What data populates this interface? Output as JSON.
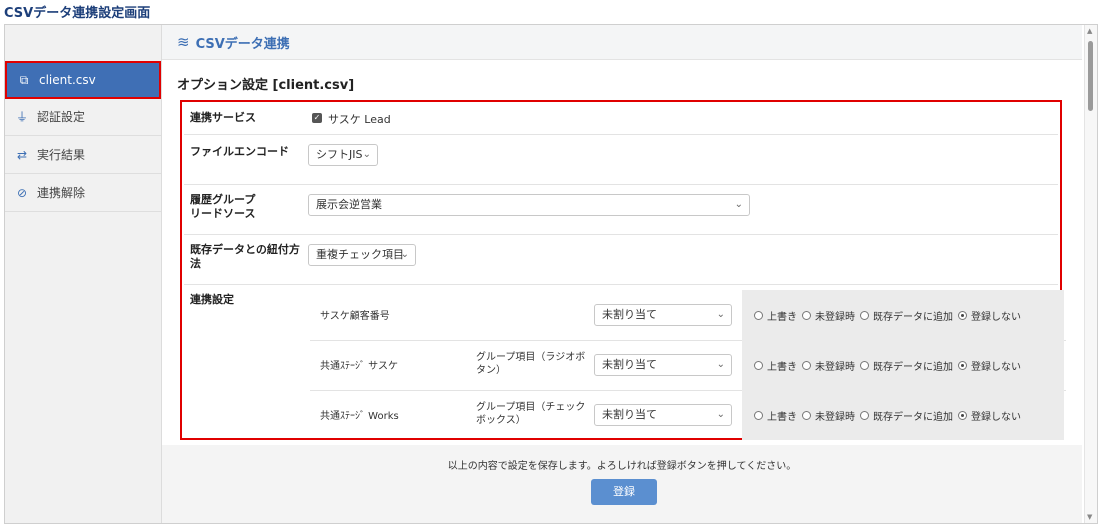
{
  "page_title": "CSVデータ連携設定画面",
  "sidebar": {
    "items": [
      {
        "label": "client.csv",
        "icon": "file-csv-icon",
        "glyph": "⧉"
      },
      {
        "label": "認証設定",
        "icon": "plug-icon",
        "glyph": "⏚"
      },
      {
        "label": "実行結果",
        "icon": "sync-icon",
        "glyph": "⇄"
      },
      {
        "label": "連携解除",
        "icon": "unlink-icon",
        "glyph": "⊘"
      }
    ]
  },
  "header": {
    "title": "CSVデータ連携",
    "logo_icon": "layers-icon",
    "logo_glyph": "≋"
  },
  "section": {
    "title": "オプション設定 [client.csv]"
  },
  "form": {
    "service": {
      "label": "連携サービス",
      "value": "サスケ Lead",
      "checked": true
    },
    "encoding": {
      "label": "ファイルエンコード",
      "value": "シフトJIS"
    },
    "history": {
      "label_line1": "履歴グループ",
      "label_line2": "リードソース",
      "value": "展示会逆営業"
    },
    "matching": {
      "label_line1": "既存データとの紐付方",
      "label_line2": "法",
      "value": "重複チェック項目"
    },
    "mapping": {
      "label": "連携設定",
      "rows": [
        {
          "col1": "サスケ顧客番号",
          "col2": "",
          "select": "未割り当て",
          "options": [
            "上書き",
            "未登録時",
            "既存データに追加",
            "登録しない"
          ],
          "selected": 3
        },
        {
          "col1": "共通ｽﾃｰｼﾞ サスケ",
          "col2": "グループ項目（ラジオボタン）",
          "select": "未割り当て",
          "options": [
            "上書き",
            "未登録時",
            "既存データに追加",
            "登録しない"
          ],
          "selected": 3
        },
        {
          "col1": "共通ｽﾃｰｼﾞ Works",
          "col2": "グループ項目（チェックボックス）",
          "select": "未割り当て",
          "options": [
            "上書き",
            "未登録時",
            "既存データに追加",
            "登録しない"
          ],
          "selected": 3
        }
      ]
    }
  },
  "footer": {
    "note": "以上の内容で設定を保存します。よろしければ登録ボタンを押してください。",
    "register_label": "登録"
  },
  "colors": {
    "accent": "#3f6fb5",
    "highlight_border": "#e00000",
    "button": "#5b8fd0"
  }
}
